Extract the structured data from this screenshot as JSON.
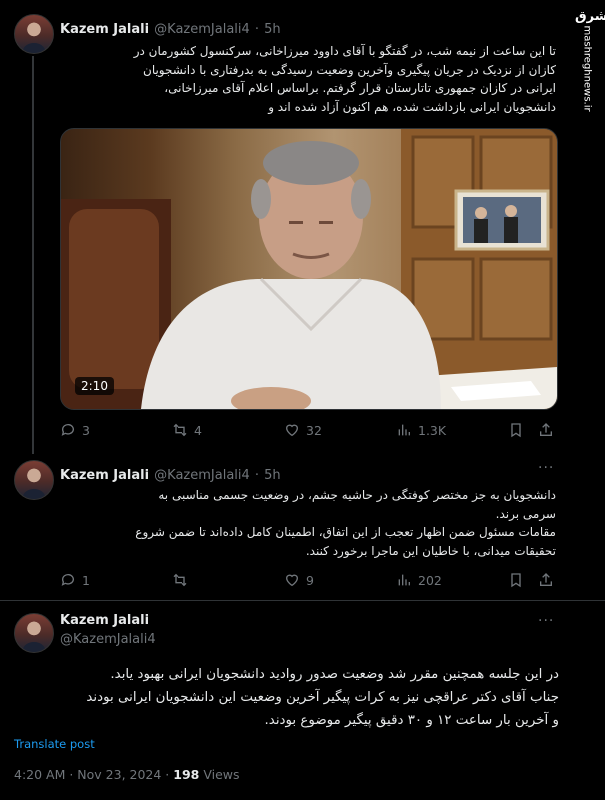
{
  "tweets": [
    {
      "name": "Kazem Jalali",
      "handle": "@KazemJalali4",
      "sep": "·",
      "time": "5h",
      "text_lines": [
        "تا این ساعت از نیمه شب، در گفتگو با آقای داوود میرزاخانی، سرکنسول کشورمان در",
        "کازان از نزدیک در جریان پیگیری وآخرین وضعیت رسیدگی به بدرفتاری با دانشجویان",
        "ایرانی در کازان جمهوری تاتارستان قرار گرفتم. براساس اعلام آقای میرزاخانی،",
        "دانشجویان ایرانی بازداشت شده، هم اکنون آزاد شده اند و"
      ],
      "video_duration": "2:10",
      "replies": "3",
      "reposts": "4",
      "likes": "32",
      "views": "1.3K"
    },
    {
      "name": "Kazem Jalali",
      "handle": "@KazemJalali4",
      "sep": "·",
      "time": "5h",
      "text_lines": [
        "دانشجویان به جز مختصر کوفتگی در حاشیه جشم، در وضعیت جسمی مناسبی به",
        "سرمی برند.",
        "مقامات مسئول ضمن اظهار تعجب از این اتفاق، اطمینان کامل داده‌اند تا ضمن شروع",
        "تحقیقات میدانی، با خاطیان این ماجرا برخورد کنند."
      ],
      "replies": "1",
      "reposts": "",
      "likes": "9",
      "views": "202"
    },
    {
      "name": "Kazem Jalali",
      "handle": "@KazemJalali4",
      "text_lines": [
        "در این جلسه همچنین مقرر شد وضعیت صدور روادید دانشجویان ایرانی بهبود یابد.",
        "جناب آقای دکتر عراقچی نیز به کرات پیگیر آخرین وضعیت این دانشجویان ایرانی بودند",
        "و آخرین بار ساعت ۱۲ و ۳۰ دقیق پیگیر موضوع بودند."
      ],
      "translate": "Translate post",
      "timestamp": "4:20 AM · Nov 23, 2024 ·",
      "views_count": "198",
      "views_label": "Views"
    }
  ],
  "watermark": {
    "brand": "مشرق",
    "url": "mashreghnews.ir"
  },
  "colors": {
    "background": "#000000",
    "text": "#e7e9ea",
    "muted": "#71767b",
    "link": "#1d9bf0"
  }
}
